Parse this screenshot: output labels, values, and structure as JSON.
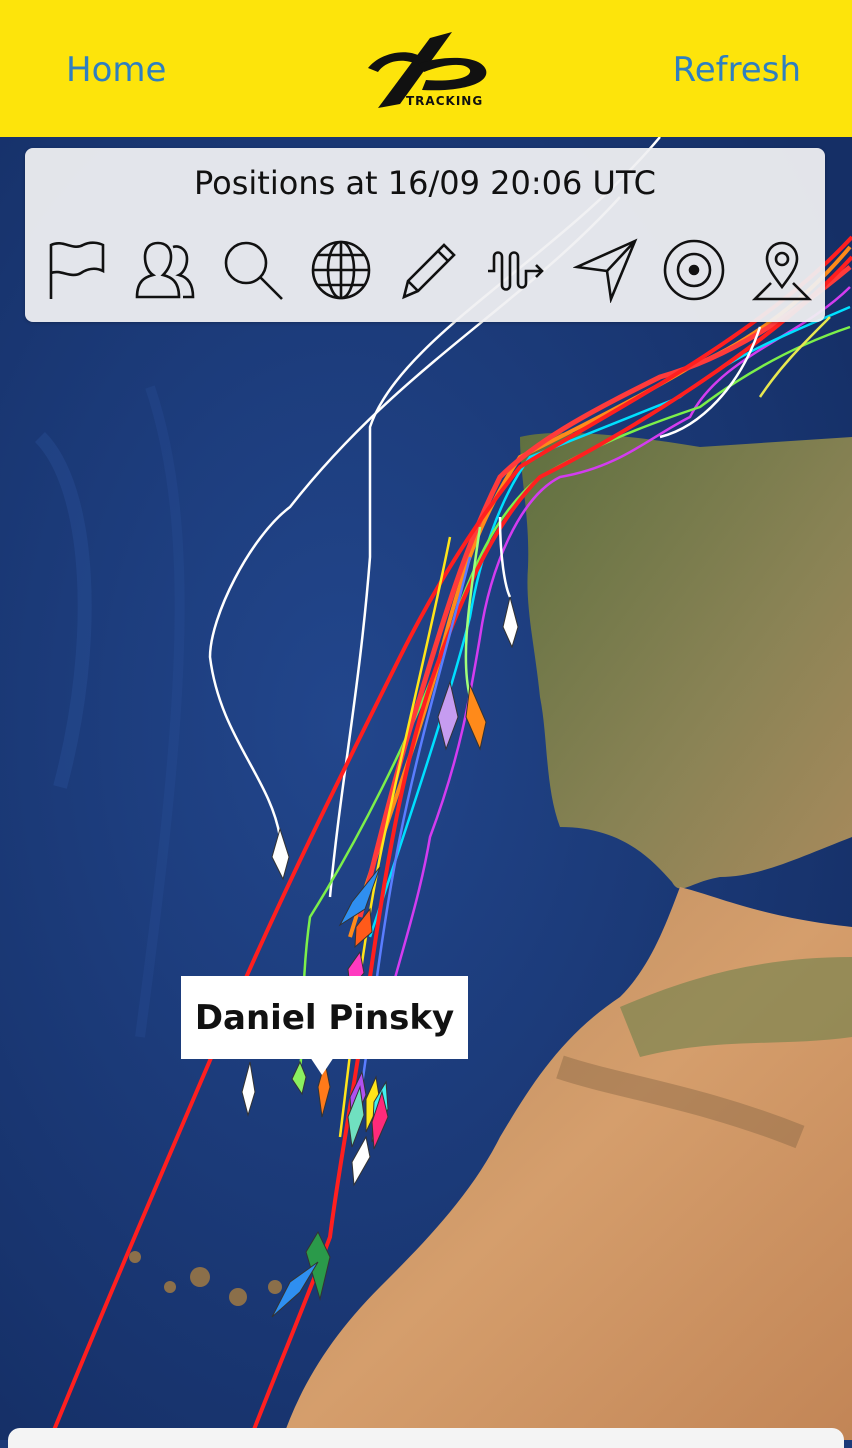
{
  "header": {
    "home_label": "Home",
    "refresh_label": "Refresh",
    "logo_text": "TRACKING"
  },
  "panel": {
    "positions_label": "Positions at 16/09 20:06 UTC",
    "tools": [
      {
        "icon": "flag-icon"
      },
      {
        "icon": "people-icon"
      },
      {
        "icon": "search-icon"
      },
      {
        "icon": "globe-icon"
      },
      {
        "icon": "pencil-icon"
      },
      {
        "icon": "wave-arrow-icon"
      },
      {
        "icon": "navigation-arrow-icon"
      },
      {
        "icon": "target-icon"
      },
      {
        "icon": "map-pin-icon"
      }
    ]
  },
  "tooltip": {
    "name": "Daniel Pinsky"
  },
  "colors": {
    "header_bg": "#fde40b",
    "link": "#2f7fc0",
    "ocean": "#1c3a78",
    "land_green": "#6e7d4a",
    "land_desert": "#c9956a"
  }
}
